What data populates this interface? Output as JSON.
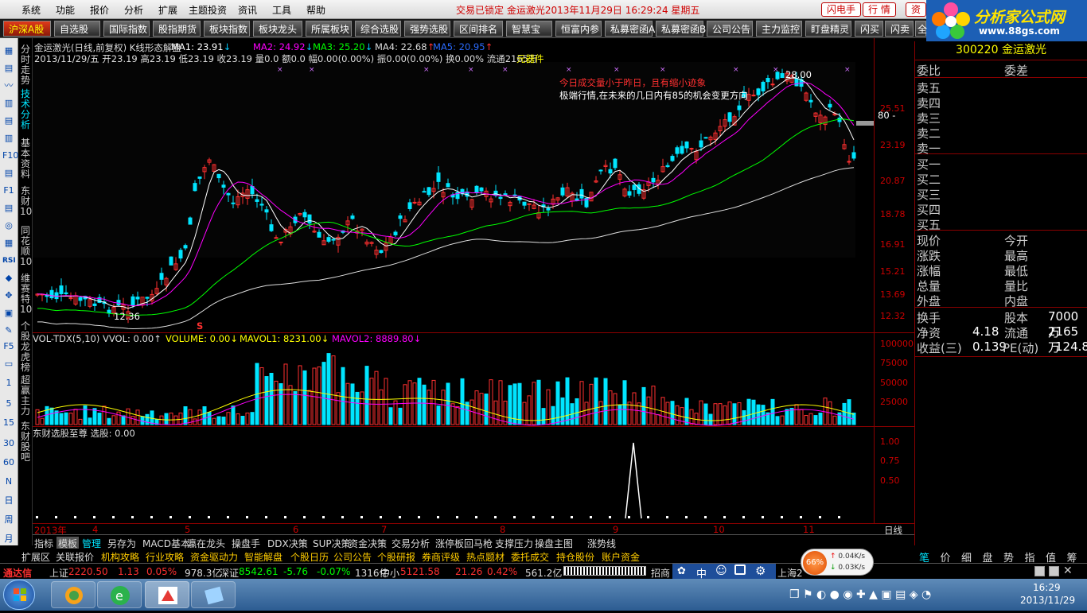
{
  "menu": {
    "items": [
      "系统",
      "功能",
      "报价",
      "分析",
      "扩展",
      "主题投资",
      "资讯",
      "工具",
      "帮助"
    ],
    "status": "交易已锁定   金运激光2013年11月29日  16:29:24  星期五",
    "buttons": [
      "闪电手",
      "行  情",
      "资"
    ]
  },
  "logo": {
    "title": "分析家公式网",
    "url": "www.88gs.com"
  },
  "toolbar": [
    "沪深A股",
    "自选股",
    "国际指数",
    "股指期货",
    "板块指数",
    "板块龙头",
    "所属板块",
    "综合选股",
    "强势选股",
    "区间排名",
    "智慧宝",
    "恒富内参",
    "私募密函A",
    "私募密函B",
    "公司公告",
    "主力监控",
    "盯盘精灵",
    "闪买",
    "闪卖",
    "全"
  ],
  "left_icons": [
    "▦",
    "▤",
    "〰",
    "▥",
    "▤",
    "▥",
    "F10",
    "▤",
    "F1",
    "▤",
    "◎",
    "▦",
    "RSI",
    "◆",
    "✥",
    "▣",
    "✎",
    "F5",
    "▭",
    "1",
    "5",
    "15",
    "30",
    "60",
    "N",
    "日",
    "周",
    "月"
  ],
  "vtabs": [
    "分时走势",
    "技术分析",
    "基本资料",
    "东财10",
    "同花顺10",
    "维赛特10",
    "个股龙虎榜",
    "超赢主力",
    "东财股吧"
  ],
  "kline": {
    "title": "金运激光(日线,前复权) K线形态解盘",
    "ma": [
      {
        "label": "MA1: 23.91",
        "arrow": "↓",
        "color": "#ffffff"
      },
      {
        "label": "MA2: 24.92",
        "arrow": "↓",
        "color": "#ff00ff"
      },
      {
        "label": "MA3: 25.20",
        "arrow": "↓",
        "color": "#00ff00"
      },
      {
        "label": "MA4: 22.68",
        "arrow": "↑",
        "color": "#dddddd"
      },
      {
        "label": "MA5: 20.95",
        "arrow": "↑",
        "color": "#0060ff"
      }
    ],
    "info": "2013/11/29/五 开23.19 高23.19 低23.19 收23.19 量0.0 额0.0 幅0.00(0.00%) 振0.00(0.00%) 换0.00% 流通2165万",
    "info_suffix": "元器件",
    "annot1": "今日成交量小于昨日，且有缩小迹象",
    "annot2": "极端行情,在未来的几日内有85的机会变更方向",
    "high_label": "28.00",
    "low_label": "12.36",
    "badge": "80 -",
    "yaxis": [
      "25.51",
      "23.19",
      "20.87",
      "18.78",
      "16.91",
      "15.21",
      "13.69",
      "12.32"
    ],
    "s_mark": "S"
  },
  "vol": {
    "header": [
      "VOL-TDX(5,10) VVOL: 0.00↑",
      "VOLUME: 0.00↓",
      "MAVOL1: 8231.00↓",
      "MAVOL2: 8889.80↓"
    ],
    "yaxis": [
      "100000",
      "75000",
      "50000",
      "25000"
    ]
  },
  "ind": {
    "header": "东财选股至尊  选股: 0.00",
    "yaxis": [
      "1.00",
      "0.75",
      "0.50"
    ]
  },
  "dates": [
    "2013年",
    "4",
    "5",
    "6",
    "7",
    "8",
    "9",
    "10",
    "11"
  ],
  "period": "日线",
  "right": {
    "code": "300220",
    "name": "金运激光",
    "weibi": "委比",
    "weicha": "委差",
    "sell": [
      "卖五",
      "卖四",
      "卖三",
      "卖二",
      "卖一"
    ],
    "buy": [
      "买一",
      "买二",
      "买三",
      "买四",
      "买五"
    ],
    "quote": [
      [
        "现价",
        "今开"
      ],
      [
        "涨跌",
        "最高"
      ],
      [
        "涨幅",
        "最低"
      ],
      [
        "总量",
        "量比"
      ],
      [
        "外盘",
        "内盘"
      ]
    ],
    "stats": [
      [
        "换手",
        "股本",
        "7000万"
      ],
      [
        "净资",
        "4.18",
        "流通",
        "2165万"
      ],
      [
        "收益(三)",
        "0.139",
        "PE(动)",
        "124.8"
      ]
    ]
  },
  "bottom_tabs": [
    "指标",
    "模板",
    "管理",
    "另存为",
    "MACD基本",
    "瀛在龙头",
    "操盘手",
    "DDX决策",
    "SUP决策",
    "资金决策",
    "交易分析",
    "涨停板回马枪",
    "支撑压力",
    "操盘主图",
    "涨势线"
  ],
  "bottom_tabs2": [
    "扩展区",
    "关联报价",
    "机构攻略",
    "行业攻略",
    "资金驱动力",
    "智能解盘",
    "个股日历",
    "公司公告",
    "个股研报",
    "券商评级",
    "热点题材",
    "委托成交",
    "持仓股份",
    "账户资金"
  ],
  "right_btabs": [
    "笔",
    "价",
    "细",
    "盘",
    "势",
    "指",
    "值",
    "筹"
  ],
  "ticker": {
    "brand": "通达信",
    "items": [
      {
        "name": "上证",
        "val": "2220.50",
        "chg": "1.13",
        "pct": "0.05%",
        "amt": "978.3亿"
      },
      {
        "name": "深证",
        "val": "8542.61",
        "chg": "-5.76",
        "pct": "-0.07%",
        "amt": "1316亿"
      },
      {
        "name": "中小",
        "val": "5121.58",
        "chg": "21.26",
        "pct": "0.42%",
        "amt": "561.2亿"
      }
    ],
    "tail": "招商",
    "net_pct": "66%",
    "net_up": "0.04K/s",
    "net_down": "0.03K/s",
    "ime": [
      "中",
      "☺"
    ],
    "shanghai": "上海2"
  },
  "taskbar": {
    "time": "16:29",
    "date": "2013/11/29"
  },
  "colors": {
    "up": "#ff3030",
    "down": "#00e5ff",
    "frame": "#8b0000"
  }
}
